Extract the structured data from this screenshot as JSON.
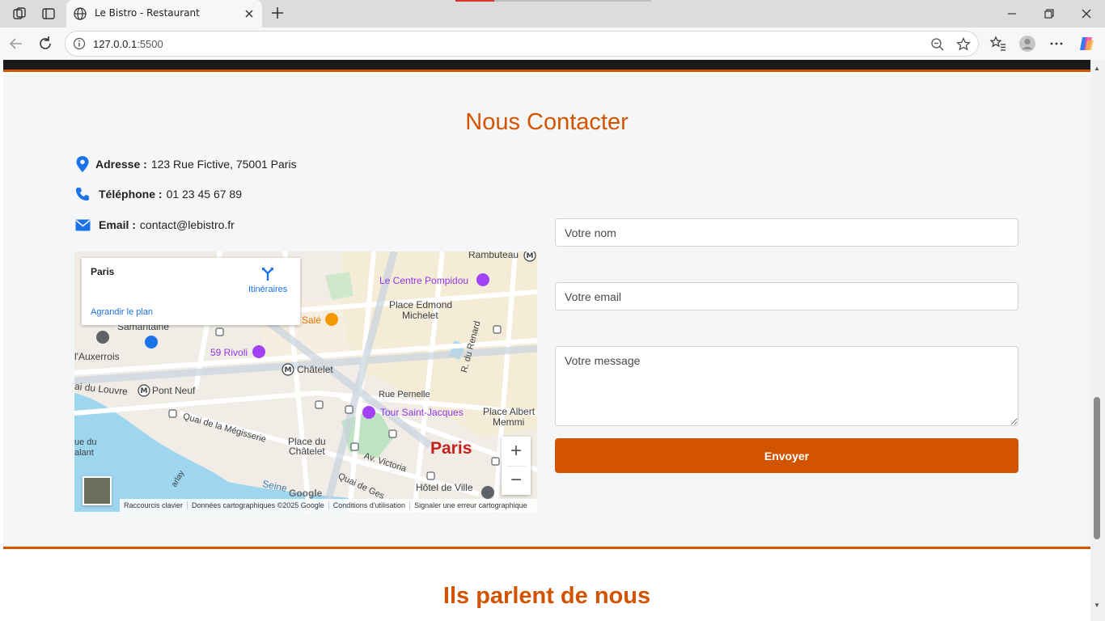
{
  "browser": {
    "tab_title": "Le Bistro - Restaurant",
    "url_host": "127.0.0.1",
    "url_port": ":5500"
  },
  "contact": {
    "title": "Nous Contacter",
    "address_label": "Adresse :",
    "address_value": "123 Rue Fictive, 75001 Paris",
    "phone_label": "Téléphone :",
    "phone_value": "01 23 45 67 89",
    "email_label": "Email :",
    "email_value": "contact@lebistro.fr",
    "accent_color": "#d35400"
  },
  "map": {
    "place": "Paris",
    "directions": "Itinéraires",
    "enlarge": "Agrandir le plan",
    "labels": {
      "rambuteau": "Rambuteau",
      "pompidou": "Le Centre Pompidou",
      "edmond": "Place Edmond",
      "michelet": "Michelet",
      "samaritaine": "Samaritaine",
      "sale": "Salé",
      "rivoli": "59 Rivoli",
      "chatelet": "Châtelet",
      "auxerrois": "l'Auxerrois",
      "louvre": "ai du Louvre",
      "pont_neuf": "Pont Neuf",
      "renard": "R. du Renard",
      "pernelle": "Rue Pernelle",
      "place_albert": "Place Albert",
      "memmi": "Memmi",
      "quai_megisserie": "Quai de la Mégisserie",
      "tour_saint_jacques": "Tour Saint-Jacques",
      "place_du": "Place du",
      "chatelet2": "Châtelet",
      "paris_big": "Paris",
      "av_victoria": "Av. Victoria",
      "seine": "Seine",
      "quai_gesvres": "Quai de Ges",
      "hotel_de_ville": "Hôtel de Ville",
      "pont_du": "ue du",
      "galant": "alant",
      "arlay": "arlay"
    },
    "google": "Google",
    "attribution": {
      "shortcuts": "Raccourcis clavier",
      "data": "Données cartographiques ©2025 Google",
      "terms": "Conditions d'utilisation",
      "report": "Signaler une erreur cartographique"
    },
    "zoom_in": "+",
    "zoom_out": "−"
  },
  "form": {
    "name_label": "Nom",
    "name_placeholder": "Votre nom",
    "email_label": "Email",
    "email_placeholder": "Votre email",
    "message_label": "Message",
    "message_placeholder": "Votre message",
    "submit": "Envoyer"
  },
  "testimonials": {
    "title": "Ils parlent de nous"
  }
}
